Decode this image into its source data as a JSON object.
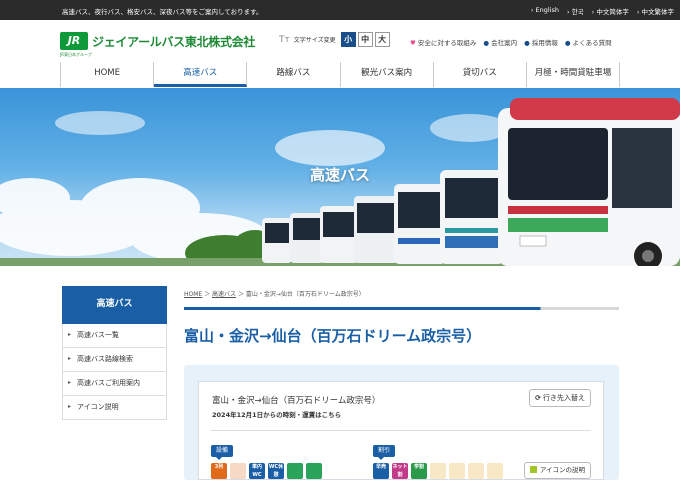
{
  "topbar": {
    "tagline": "高速バス、夜行バス、格安バス、深夜バス等をご案内しております。",
    "languages": [
      "English",
      "한국",
      "中文简体字",
      "中文繁体字"
    ]
  },
  "header": {
    "logo_mark": "JR",
    "logo_sub": "JR東日本グループ",
    "company": "ジェイアールバス東北株式会社",
    "font_size_label": "文字サイズ変更",
    "font_sizes": [
      "小",
      "中",
      "大"
    ],
    "font_size_active": "小",
    "utility_links": [
      "安全に対する取組み",
      "会社案内",
      "採用情報",
      "よくある質問"
    ]
  },
  "nav": {
    "items": [
      "HOME",
      "高速バス",
      "路線バス",
      "観光バス案内",
      "貸切バス",
      "月極・時間貸駐車場"
    ],
    "active": "高速バス"
  },
  "hero": {
    "title": "高速バス"
  },
  "sidebar": {
    "heading": "高速バス",
    "links": [
      "高速バス一覧",
      "高速バス路線検索",
      "高速バスご利用案内",
      "アイコン説明"
    ]
  },
  "breadcrumb": {
    "home": "HOME",
    "section": "高速バス",
    "current": "富山・金沢→仙台（百万石ドリーム政宗号）"
  },
  "page": {
    "title": "富山・金沢→仙台（百万石ドリーム政宗号）",
    "card_title": "富山・金沢→仙台（百万石ドリーム政宗号）",
    "card_note": "2024年12月1日からの時刻・運賃はこちら",
    "swap_button": "行き先入替え",
    "facilities_label": "設備",
    "discounts_label": "割引",
    "icon_help": "アイコンの説明"
  },
  "facility_icons": [
    {
      "name": "seat-3row-icon",
      "text": "3列",
      "color": "#e06a1a",
      "faded": false
    },
    {
      "name": "seat-4row-icon",
      "text": "",
      "color": "#e06a1a",
      "faded": true
    },
    {
      "name": "restroom-icon",
      "text": "車内WC",
      "color": "#1a5fa6",
      "faded": false
    },
    {
      "name": "wc-break-icon",
      "text": "WC休憩",
      "color": "#1a5fa6",
      "faded": false
    },
    {
      "name": "wifi-icon",
      "text": "",
      "color": "#2aa45a",
      "faded": false
    },
    {
      "name": "outlet-icon",
      "text": "",
      "color": "#2aa45a",
      "faded": false
    }
  ],
  "discount_icons": [
    {
      "name": "early-discount-icon",
      "text": "早売",
      "color": "#1a5fa6",
      "faded": false
    },
    {
      "name": "net-discount-icon",
      "text": "ネット割",
      "color": "#c23a8a",
      "faded": false
    },
    {
      "name": "student-discount-icon",
      "text": "学割",
      "color": "#2a9a4a",
      "faded": false
    },
    {
      "name": "discount-icon-4",
      "text": "",
      "color": "#e6a21a",
      "faded": true
    },
    {
      "name": "discount-icon-5",
      "text": "",
      "color": "#e6a21a",
      "faded": true
    },
    {
      "name": "discount-icon-6",
      "text": "",
      "color": "#e6a21a",
      "faded": true
    },
    {
      "name": "discount-icon-7",
      "text": "",
      "color": "#e6a21a",
      "faded": true
    }
  ]
}
